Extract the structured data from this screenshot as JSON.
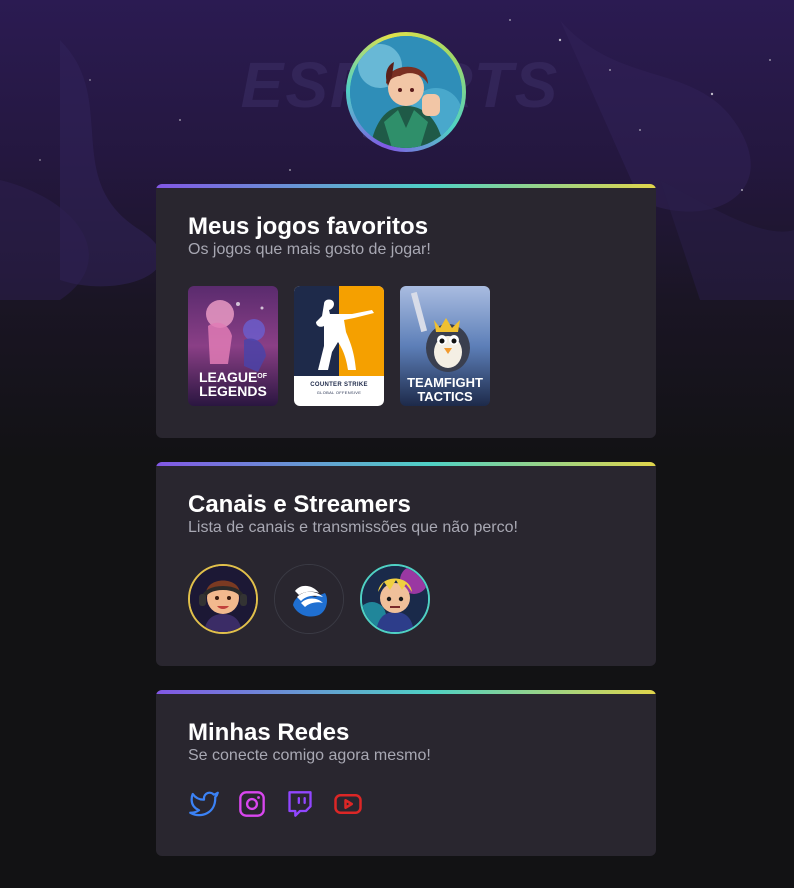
{
  "avatar": {
    "icon": "profile-avatar-icon"
  },
  "background": {
    "watermark_text": "ESPORTS",
    "watermark_sub": "<nlw/>"
  },
  "games_card": {
    "title": "Meus jogos favoritos",
    "subtitle": "Os jogos que mais gosto de jogar!",
    "games": [
      {
        "line1": "LEAGUE",
        "of": "OF",
        "line2": "LEGENDS",
        "icon": "league-of-legends-cover"
      },
      {
        "brand": "COUNTER STRIKE",
        "tagline": "GLOBAL OFFENSIVE",
        "icon": "counter-strike-cover"
      },
      {
        "line1": "TEAMFIGHT",
        "line2": "TACTICS",
        "icon": "teamfight-tactics-cover"
      }
    ]
  },
  "streamers_card": {
    "title": "Canais e Streamers",
    "subtitle": "Lista de canais e transmissões que não perco!",
    "streamers": [
      {
        "icon": "streamer-headset-avatar",
        "ring": "#e1c04b"
      },
      {
        "icon": "winged-logo-avatar",
        "ring": "#3a3a44"
      },
      {
        "icon": "streamer-gamer-avatar",
        "ring": "#4fd1c5"
      }
    ]
  },
  "social_card": {
    "title": "Minhas Redes",
    "subtitle": "Se conecte comigo agora mesmo!",
    "links": [
      {
        "icon": "twitter-icon",
        "color": "#3b82f6"
      },
      {
        "icon": "instagram-icon",
        "color": "#d946ef"
      },
      {
        "icon": "twitch-icon",
        "color": "#9146ff"
      },
      {
        "icon": "youtube-icon",
        "color": "#dc2626"
      }
    ]
  }
}
